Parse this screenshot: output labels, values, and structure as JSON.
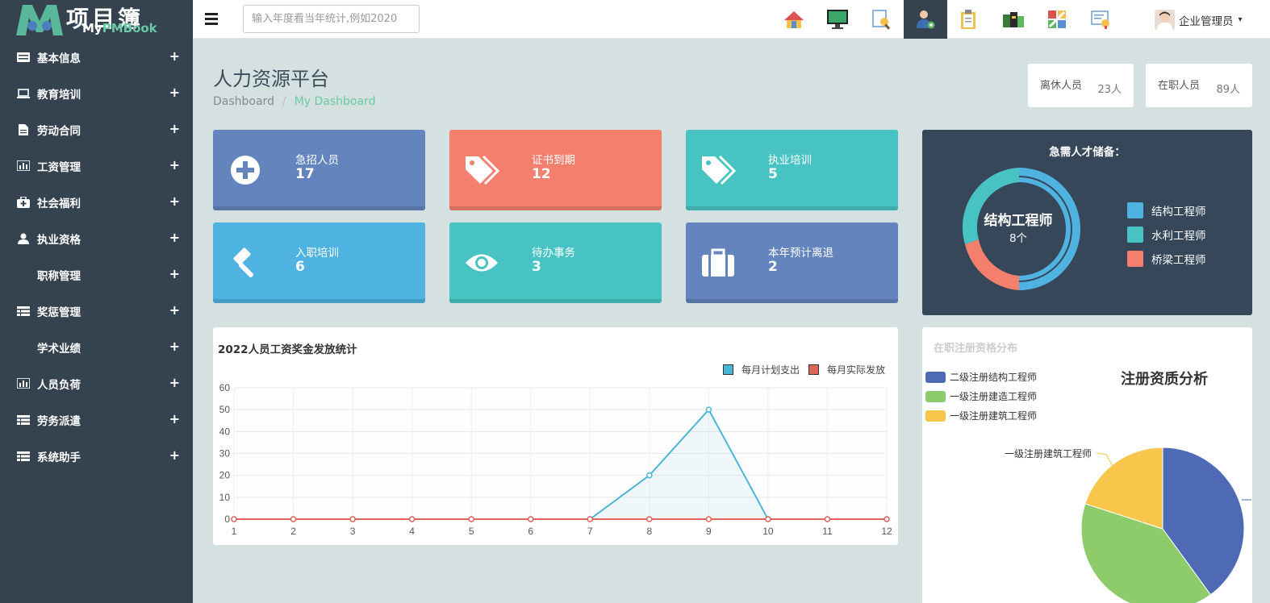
{
  "app": {
    "logo_cn": "项目簿",
    "logo_en_prefix": "My",
    "logo_en_pm": "PMBook"
  },
  "sidebar": {
    "items": [
      {
        "label": "基本信息",
        "icon": "id-card-icon"
      },
      {
        "label": "教育培训",
        "icon": "laptop-icon"
      },
      {
        "label": "劳动合同",
        "icon": "file-icon"
      },
      {
        "label": "工资管理",
        "icon": "bar-chart-icon"
      },
      {
        "label": "社会福利",
        "icon": "medkit-icon"
      },
      {
        "label": "执业资格",
        "icon": "user-tie-icon"
      },
      {
        "label": "职称管理",
        "icon": ""
      },
      {
        "label": "奖惩管理",
        "icon": "table-icon"
      },
      {
        "label": "学术业绩",
        "icon": ""
      },
      {
        "label": "人员负荷",
        "icon": "bar-chart-icon"
      },
      {
        "label": "劳务派遣",
        "icon": "table-icon"
      },
      {
        "label": "系统助手",
        "icon": "table-icon"
      }
    ],
    "expand_symbol": "+"
  },
  "topbar": {
    "search_placeholder": "输入年度看当年统计,例如2020",
    "icons": [
      "home-icon",
      "monitor-icon",
      "search-doc-icon",
      "person-settings-icon",
      "clipboard-icon",
      "books-icon",
      "chart-doc-icon",
      "certificate-icon"
    ],
    "active_icon_index": 3,
    "user_name": "企业管理员",
    "caret": "▾"
  },
  "header": {
    "title": "人力资源平台",
    "breadcrumb_root": "Dashboard",
    "breadcrumb_sep": "/",
    "breadcrumb_current": "My Dashboard"
  },
  "stats": [
    {
      "label": "离休人员",
      "value": "23人"
    },
    {
      "label": "在职人员",
      "value": "89人"
    }
  ],
  "tiles": [
    {
      "label": "急招人员",
      "value": "17",
      "icon": "plus-circle-icon",
      "color": "#6384bd"
    },
    {
      "label": "证书到期",
      "value": "12",
      "icon": "tags-icon",
      "color": "#f37f6c"
    },
    {
      "label": "执业培训",
      "value": "5",
      "icon": "tags-icon",
      "color": "#48c3c3"
    },
    {
      "label": "入职培训",
      "value": "6",
      "icon": "gavel-icon",
      "color": "#4eb3e0"
    },
    {
      "label": "待办事务",
      "value": "3",
      "icon": "eye-icon",
      "color": "#48c3c3"
    },
    {
      "label": "本年预计离退",
      "value": "2",
      "icon": "briefcase-icon",
      "color": "#6384bd"
    }
  ],
  "talent": {
    "title": "急需人才储备：",
    "center_label": "结构工程师",
    "center_value": "8个",
    "legend": [
      {
        "name": "结构工程师",
        "color": "#4eb3e0"
      },
      {
        "name": "水利工程师",
        "color": "#48c3c3"
      },
      {
        "name": "桥梁工程师",
        "color": "#f37f6c"
      }
    ]
  },
  "salary_chart": {
    "chart_data": {
      "type": "line",
      "title": "2022人员工资奖金发放统计",
      "x": [
        1,
        2,
        3,
        4,
        5,
        6,
        7,
        8,
        9,
        10,
        11,
        12
      ],
      "ylim": [
        0,
        60
      ],
      "yticks": [
        0,
        10,
        20,
        30,
        40,
        50,
        60
      ],
      "grid": true,
      "legend_position": "top-right",
      "series": [
        {
          "name": "每月计划支出",
          "values": [
            0,
            0,
            0,
            0,
            0,
            0,
            0,
            20,
            50,
            0,
            0,
            0
          ],
          "color": "#4ab6d6"
        },
        {
          "name": "每月实际发放",
          "values": [
            0,
            0,
            0,
            0,
            0,
            0,
            0,
            0,
            0,
            0,
            0,
            0
          ],
          "color": "#e0665a"
        }
      ]
    }
  },
  "qualification_chart": {
    "subtitle": "在职注册资格分布",
    "chart_data": {
      "type": "pie",
      "title": "注册资质分析",
      "legend_position": "top-left",
      "slices": [
        {
          "name": "二级注册结构工程师",
          "value": 40,
          "color": "#4f6ab5"
        },
        {
          "name": "一级注册建造工程师",
          "value": 40,
          "color": "#8ecb6b"
        },
        {
          "name": "一级注册建筑工程师",
          "value": 20,
          "color": "#f8c64b"
        }
      ],
      "callout": "一级注册建筑工程师"
    }
  }
}
